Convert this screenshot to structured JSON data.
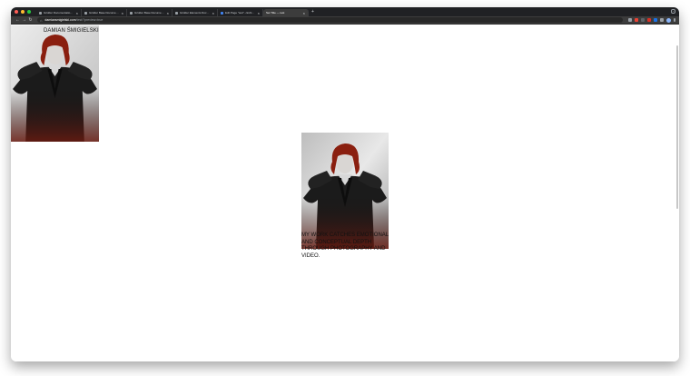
{
  "browser": {
    "tabs": [
      {
        "label": "Gridder Documentation – Sun",
        "active": false
      },
      {
        "label": "Gridder Base Documentation",
        "active": false
      },
      {
        "label": "Gridder Base Documentation",
        "active": false
      },
      {
        "label": "Gridder Elements Documen",
        "active": false
      },
      {
        "label": "Edit Page \"test\" ‹ Exhibitio",
        "active": false
      },
      {
        "label": "Set Title — test",
        "active": true
      }
    ],
    "address": {
      "host": "damiansmigielski.com",
      "path": "/test/?preview=true"
    },
    "icons": {
      "back": "←",
      "forward": "→",
      "reload": "↻",
      "lock": "⌂",
      "close": "×",
      "new_tab": "+"
    }
  },
  "page": {
    "brand": "DAMIAN ŚMIGIELSKI",
    "statement": "MY WORK CATCHES EMOTIONAL AND CONCEPTUAL DEPTH THROUGH PHOTOGRAPHY AND VIDEO."
  },
  "colors": {
    "chrome_dark": "#202124",
    "toolbar": "#3c3c3c",
    "hair": "#8a1f0f"
  }
}
